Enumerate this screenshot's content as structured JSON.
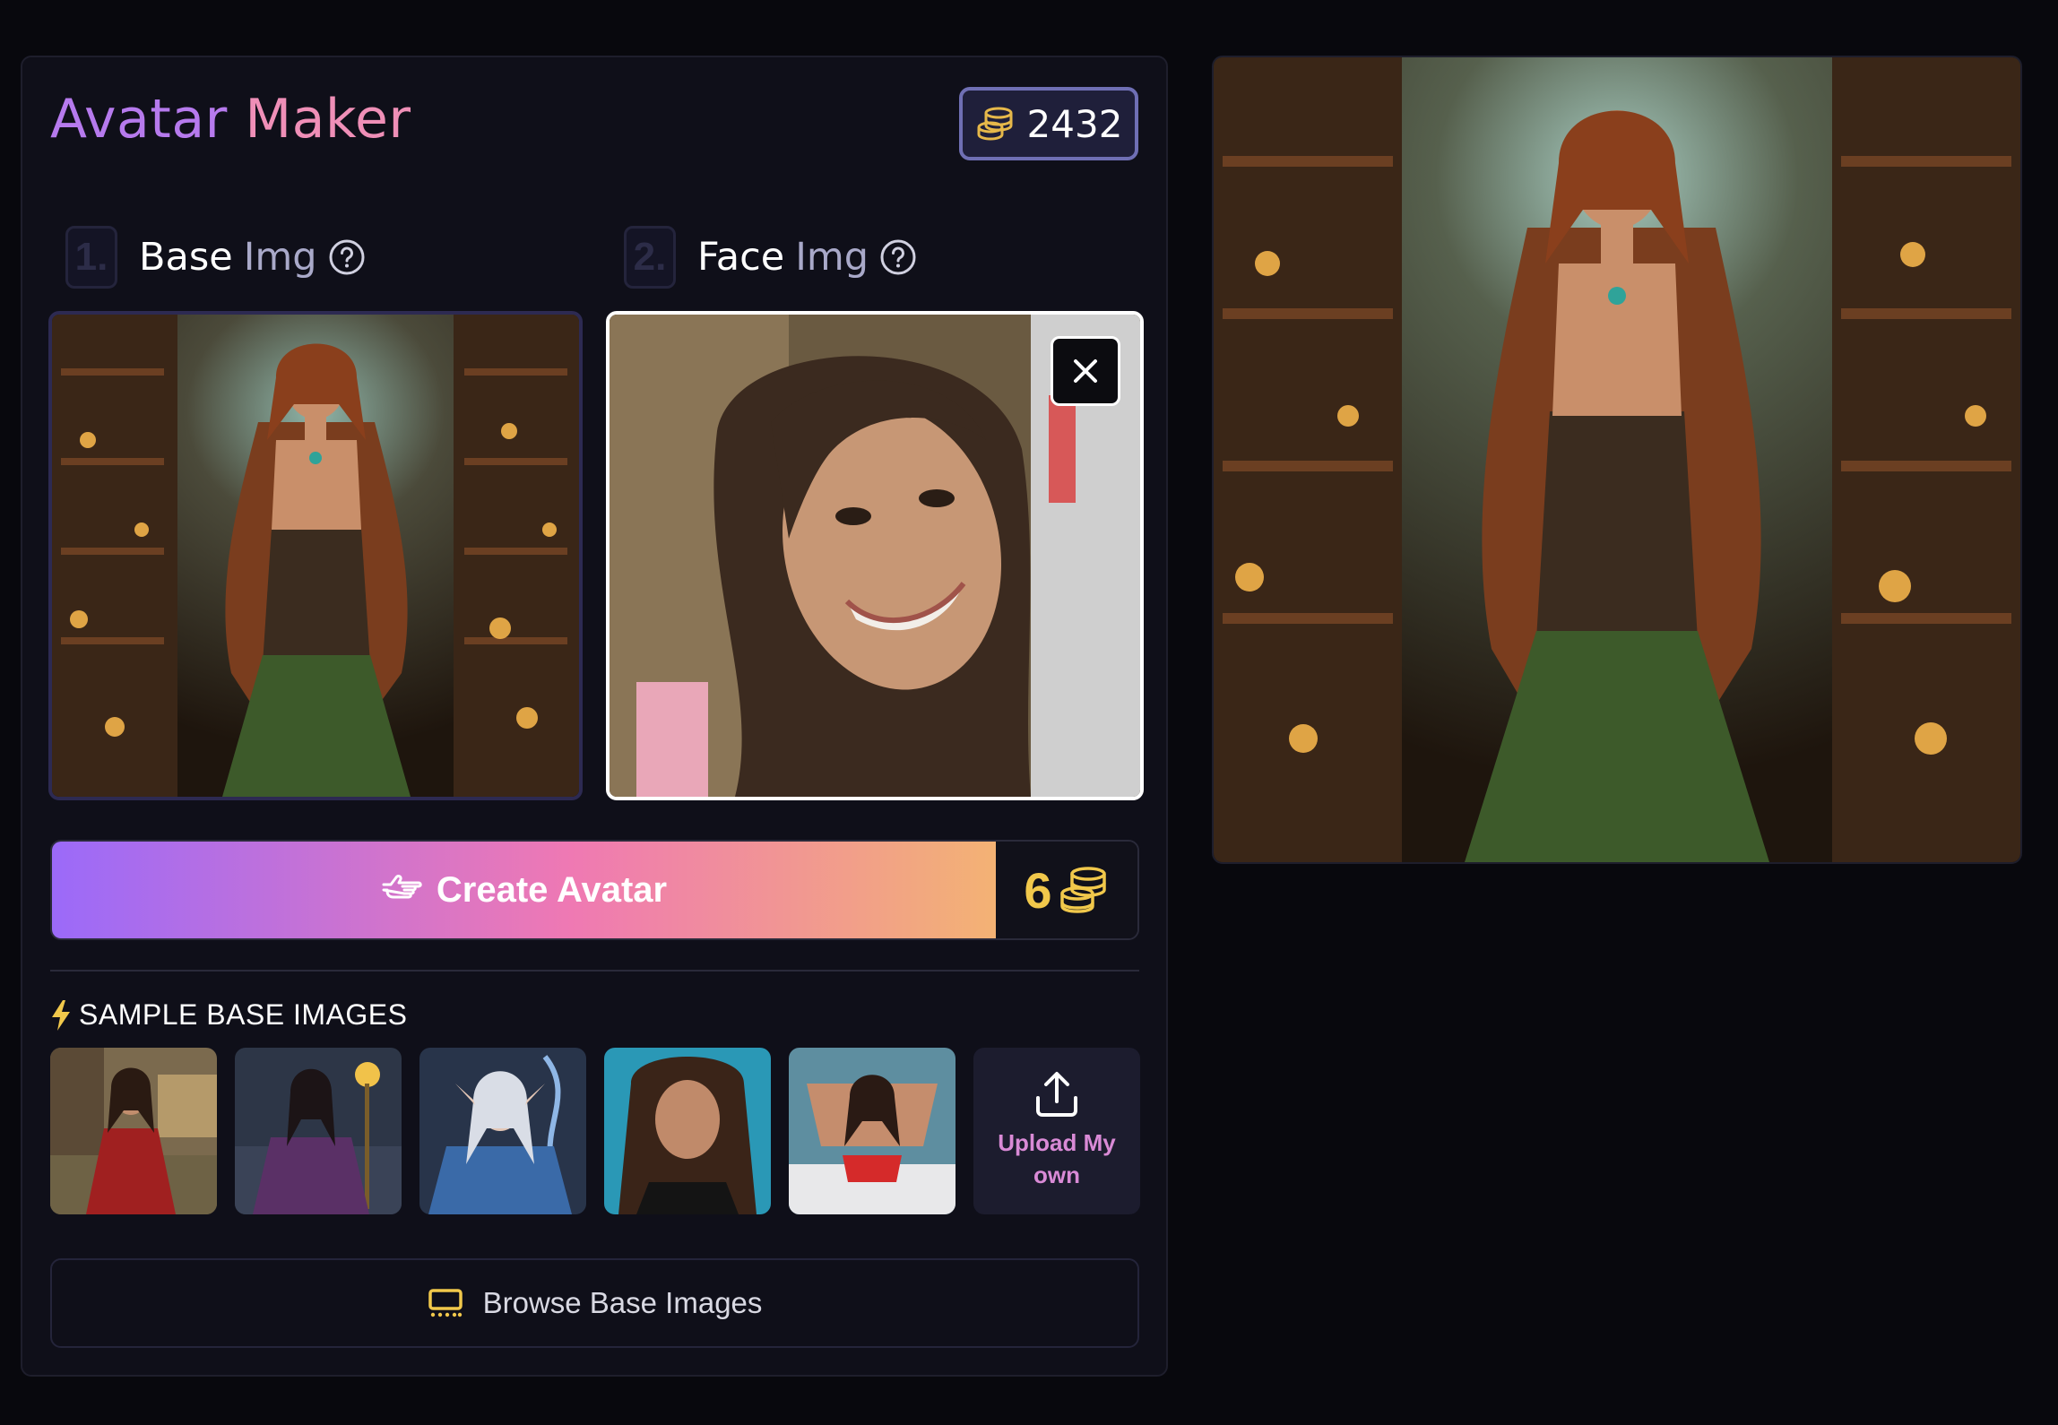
{
  "app": {
    "title_part1": "Avatar",
    "title_part2": "Maker",
    "coins": "2432"
  },
  "steps": {
    "base": {
      "num": "1.",
      "label": "Base",
      "label2": "Img"
    },
    "face": {
      "num": "2.",
      "label": "Face",
      "label2": "Img"
    }
  },
  "create": {
    "label": "Create Avatar",
    "cost": "6"
  },
  "samples": {
    "title": "SAMPLE BASE IMAGES",
    "upload_label": "Upload My own"
  },
  "browse": {
    "label": "Browse Base Images"
  },
  "colors": {
    "accent_purple": "#9b6af9",
    "accent_pink": "#ef79b3",
    "accent_orange": "#f3b274",
    "coin_gold": "#f1c84b",
    "panel_bg": "#0f0f19"
  },
  "icons": [
    "coins-icon",
    "help-icon",
    "close-icon",
    "pointing-hand-icon",
    "bolt-icon",
    "upload-icon",
    "browse-icon"
  ]
}
